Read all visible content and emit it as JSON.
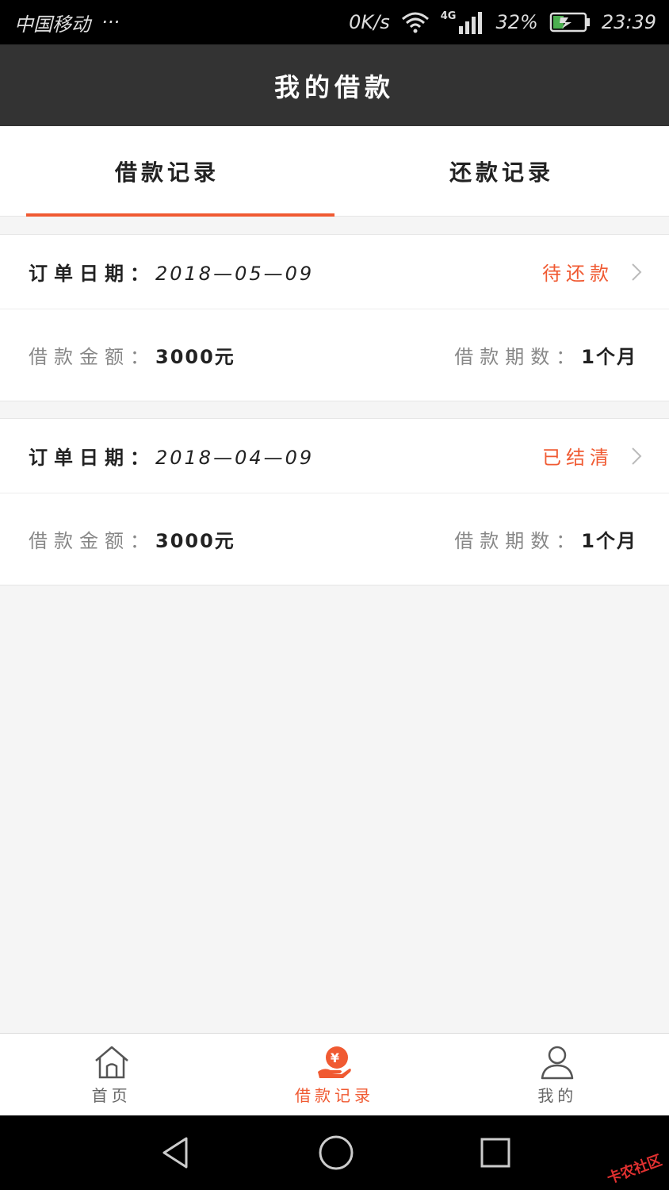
{
  "status_bar": {
    "carrier": "中国移动",
    "more": "···",
    "speed": "0K/s",
    "network": "4G",
    "battery": "32%",
    "time": "23:39"
  },
  "header": {
    "title": "我的借款"
  },
  "tabs": [
    {
      "label": "借款记录",
      "active": true
    },
    {
      "label": "还款记录",
      "active": false
    }
  ],
  "records": [
    {
      "date_label": "订单日期：",
      "date": "2018—05—09",
      "status": "待还款",
      "amount_label": "借款金额：",
      "amount": "3000元",
      "term_label": "借款期数：",
      "term": "1个月"
    },
    {
      "date_label": "订单日期：",
      "date": "2018—04—09",
      "status": "已结清",
      "amount_label": "借款金额：",
      "amount": "3000元",
      "term_label": "借款期数：",
      "term": "1个月"
    }
  ],
  "bottom_nav": [
    {
      "label": "首页",
      "icon": "home-icon"
    },
    {
      "label": "借款记录",
      "icon": "yuan-hand-icon",
      "active": true
    },
    {
      "label": "我的",
      "icon": "user-icon"
    }
  ],
  "watermark": "卡农社区",
  "colors": {
    "accent": "#f05a32",
    "header_bg": "#333333"
  }
}
